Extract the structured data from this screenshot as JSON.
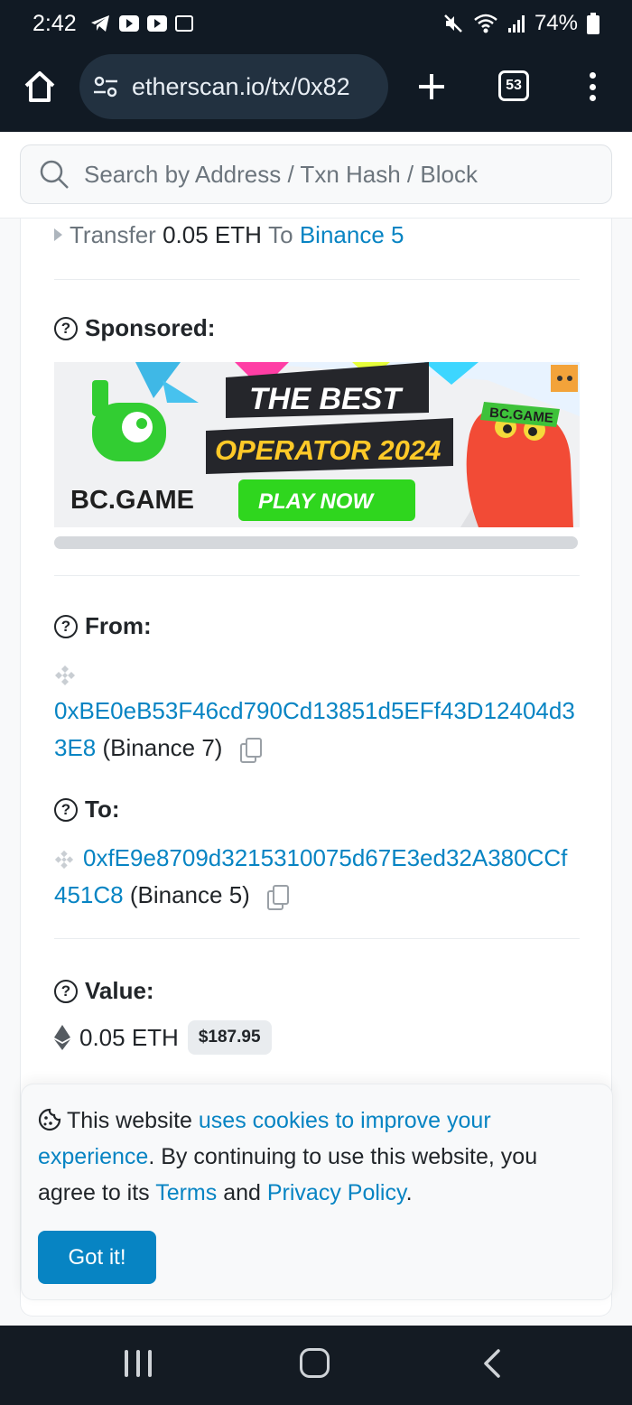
{
  "status_bar": {
    "time": "2:42",
    "battery": "74%",
    "icons": [
      "telegram-icon",
      "youtube-icon",
      "youtube-icon",
      "gallery-icon",
      "mute-icon",
      "wifi-icon",
      "signal-icon",
      "battery-icon"
    ]
  },
  "browser": {
    "url": "etherscan.io/tx/0x82",
    "tab_count": "53",
    "icons": [
      "home-icon",
      "site-settings-icon",
      "new-tab-icon",
      "tabs-icon",
      "more-menu-icon"
    ]
  },
  "search": {
    "placeholder": "Search by Address / Txn Hash / Block"
  },
  "transfer": {
    "prefix": "Transfer",
    "amount": "0.05 ETH",
    "to_word": "To",
    "recipient": "Binance 5"
  },
  "sponsored": {
    "label": "Sponsored:",
    "ad": {
      "brand": "BC.GAME",
      "headline1": "THE BEST",
      "headline2": "OPERATOR 2024",
      "cta": "PLAY NOW",
      "badge": "BC.GAME"
    }
  },
  "from": {
    "label": "From:",
    "address": "0xBE0eB53F46cd790Cd13851d5EFf43D12404d33E8",
    "name": "(Binance 7)"
  },
  "to": {
    "label": "To:",
    "address": "0xfE9e8709d3215310075d67E3ed32A380CCf451C8",
    "name": "(Binance 5)"
  },
  "value": {
    "label": "Value:",
    "amount": "0.05 ETH",
    "usd": "$187.95"
  },
  "cookie": {
    "text_before": "This website ",
    "link1": "uses cookies to improve your experience",
    "text_mid": ". By continuing to use this website, you agree to its ",
    "link2": "Terms",
    "text_and": " and ",
    "link3": "Privacy Policy",
    "text_end": ".",
    "button": "Got it!"
  },
  "colors": {
    "link": "#0784c3",
    "status_bar_bg": "#111a24",
    "url_pill_bg": "#223140",
    "button_bg": "#0784c3"
  }
}
